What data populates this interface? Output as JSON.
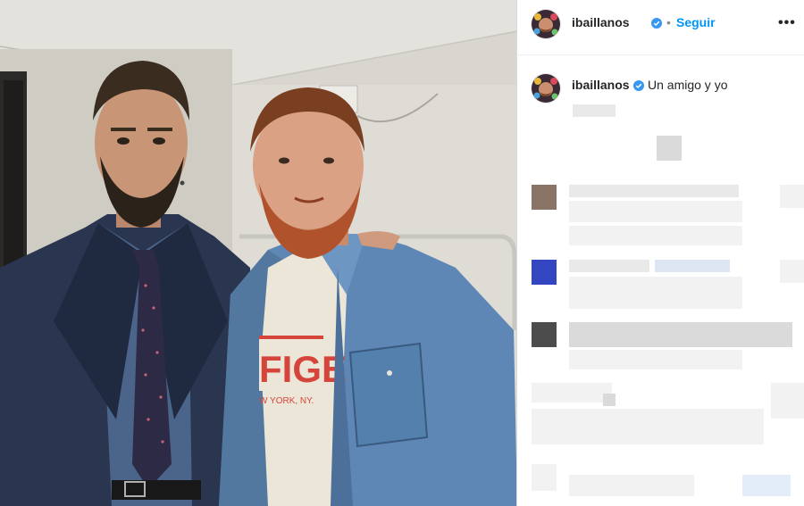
{
  "post": {
    "username": "ibaillanos",
    "verified": true,
    "separator": "•",
    "follow_label": "Seguir",
    "more_label": "•••",
    "caption_username": "ibaillanos",
    "caption_text": "Un amigo y yo",
    "shirt_print": "FIGE",
    "shirt_subprint": "W YORK, NY."
  },
  "colors": {
    "link": "#0095f6",
    "text": "#262626",
    "verified_badge": "#3897f0"
  },
  "icons": [
    "avatar",
    "verified-badge-icon",
    "more-options-icon"
  ],
  "comments_obscured": true
}
